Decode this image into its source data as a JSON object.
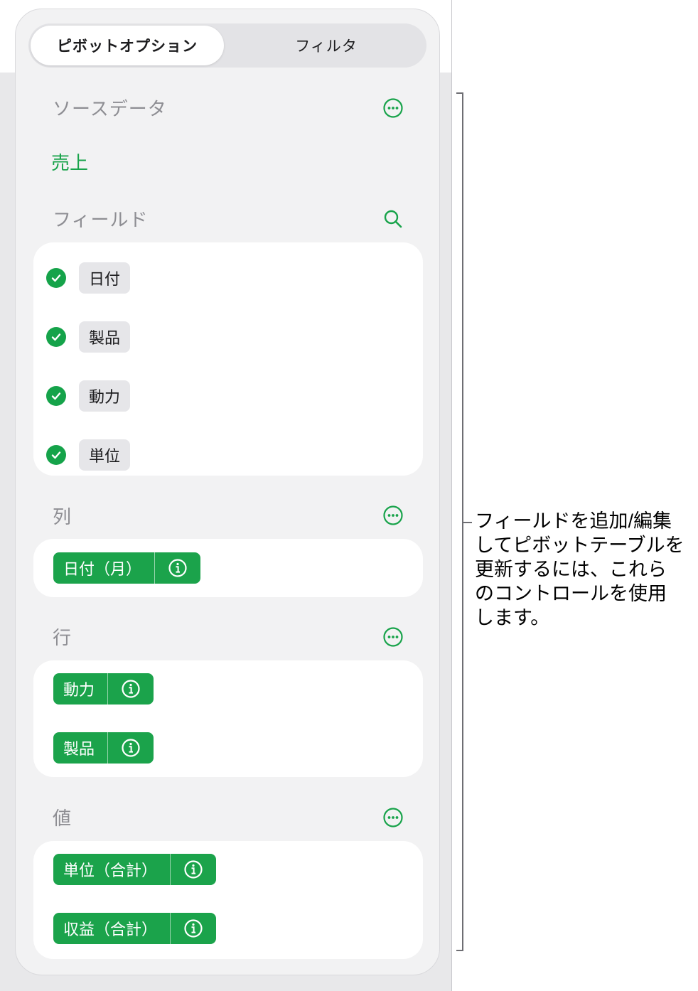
{
  "tabs": {
    "active": "ピボットオプション",
    "inactive": "フィルタ"
  },
  "source": {
    "title": "ソースデータ",
    "link": "売上"
  },
  "fields": {
    "title": "フィールド",
    "items": [
      "日付",
      "製品",
      "動力",
      "単位"
    ]
  },
  "columns": {
    "title": "列",
    "pills": [
      "日付（月）"
    ]
  },
  "rows": {
    "title": "行",
    "pills": [
      "動力",
      "製品"
    ]
  },
  "values": {
    "title": "値",
    "pills": [
      "単位（合計）",
      "収益（合計）"
    ]
  },
  "annotation": "フィールドを追加/編集\nしてピボットテーブルを\n更新するには、これら\nのコントロールを使用\nします。",
  "colors": {
    "accent": "#18a34a",
    "pill": "#1ba34b"
  }
}
